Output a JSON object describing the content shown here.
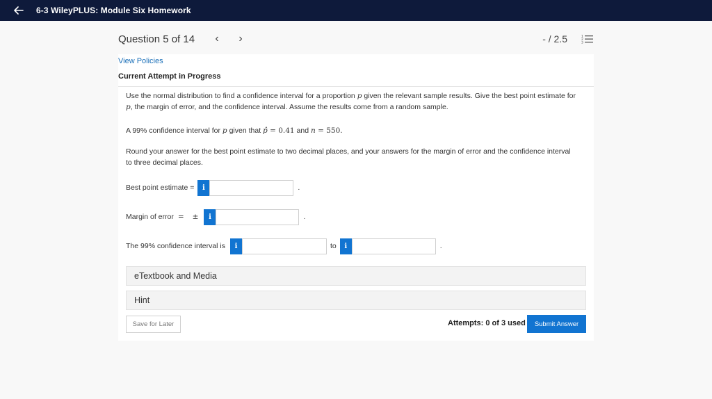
{
  "topbar": {
    "back_icon": "arrow-left-icon",
    "title": "6-3 WileyPLUS: Module Six Homework",
    "background": "#0e1a3b"
  },
  "header": {
    "question_label": "Question 5 of 14",
    "prev_glyph": "‹",
    "next_glyph": "›",
    "score": "- / 2.5",
    "list_icon": "question-list-icon"
  },
  "card": {
    "policies_link": "View Policies",
    "attempt_status": "Current Attempt in Progress"
  },
  "question": {
    "p1_a": "Use the normal distribution to find a confidence interval for a proportion ",
    "p1_var": "p",
    "p1_b": " given the relevant sample results. Give the best point estimate for ",
    "p1_var2": "p",
    "p1_c": ", the margin of error, and the confidence interval. Assume the results come from a random sample.",
    "p2_a": "A 99% confidence interval for ",
    "p2_var": "p",
    "p2_b": " given that ",
    "phat": "p̂",
    "phat_eq": " = 0.41",
    "p2_and": " and ",
    "n_var": "n",
    "n_eq": " = 550.",
    "p3": "Round your answer for the best point estimate to two decimal places, and your answers for the margin of error and the confidence interval to three decimal places."
  },
  "fields": {
    "best_label": "Best point estimate =",
    "margin_label": "Margin of error",
    "margin_eq": "=",
    "margin_pm": "±",
    "ci_label": "The 99% confidence interval is",
    "ci_to": "to",
    "period": ".",
    "info_glyph": "i",
    "best_value": "",
    "margin_value": "",
    "ci_low_value": "",
    "ci_high_value": ""
  },
  "accordions": {
    "textbook": "eTextbook and Media",
    "hint": "Hint"
  },
  "footer": {
    "save_label": "Save for Later",
    "attempts": "Attempts: 0 of 3 used",
    "submit_label": "Submit Answer",
    "accent": "#1174d1"
  }
}
